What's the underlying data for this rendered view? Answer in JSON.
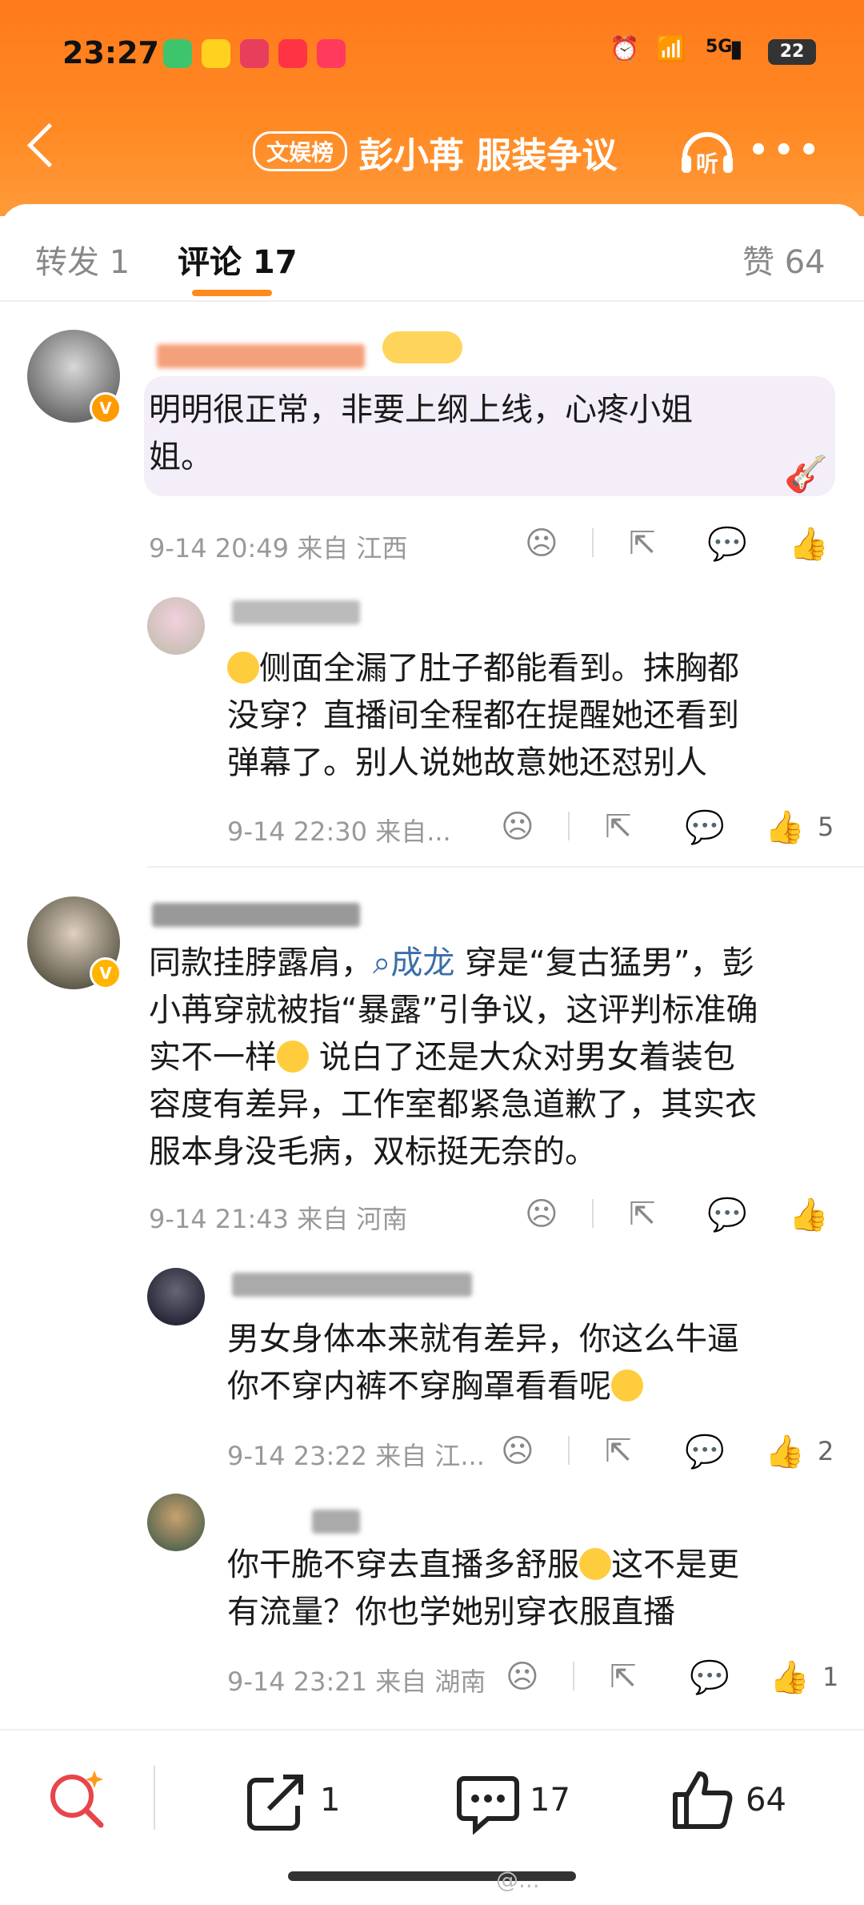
{
  "status_bar": {
    "time": "23:27",
    "network": "5G",
    "battery": "22"
  },
  "header": {
    "back_icon": "back-chevron-icon",
    "badge": "文娱榜",
    "title": "彭小苒 服装争议",
    "listen_label": "听",
    "more_icon": "more-dots-icon"
  },
  "tabs": {
    "repost": "转发 1",
    "comments": "评论 17",
    "likes": "赞 64"
  },
  "comments": [
    {
      "text_lines": [
        "明明很正常，非要上纲上线，心疼小姐",
        "姐。"
      ],
      "meta": "9-14 20:49  来自 江西",
      "like_count": ""
    },
    {
      "text_lines": [
        "侧面全漏了肚子都能看到。抹胸都",
        "没穿？直播间全程都在提醒她还看到",
        "弹幕了。别人说她故意她还怼别人"
      ],
      "meta": "9-14 22:30  来自...",
      "like_count": "5"
    },
    {
      "text_prefix": "同款挂脖露肩，",
      "link": "成龙",
      "text_lines": [
        " 穿是“复古猛男”，彭",
        "小苒穿就被指“暴露”引争议，这评判标准确",
        "实不一样",
        " 说白了还是大众对男女着装包",
        "容度有差异，工作室都紧急道歉了，其实衣",
        "服本身没毛病，双标挺无奈的。"
      ],
      "meta": "9-14 21:43  来自 河南",
      "like_count": ""
    },
    {
      "text_lines": [
        "男女身体本来就有差异，你这么牛逼",
        "你不穿内裤不穿胸罩看看呢"
      ],
      "meta": "9-14 23:22  来自 江...",
      "like_count": "2"
    },
    {
      "text_lines": [
        "你干脆不穿去直播多舒服",
        "这不是更",
        "有流量？你也学她别穿衣服直播"
      ],
      "meta": "9-14 23:21  来自 湖南",
      "like_count": "1"
    }
  ],
  "bottom_bar": {
    "repost_count": "1",
    "comment_count": "17",
    "like_count": "64"
  },
  "watermark": "@...",
  "colors": {
    "accent": "#ff8a1c",
    "link": "#3b6ea8"
  }
}
